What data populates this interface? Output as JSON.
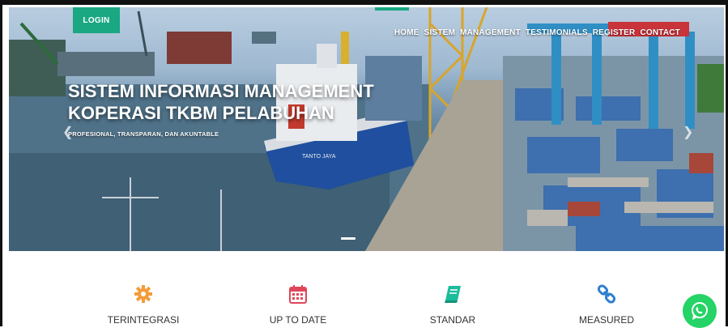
{
  "header": {
    "login_label": "LOGIN",
    "nav": [
      "HOME",
      "SISTEM",
      "MANAGEMENT",
      "TESTIMONIALS",
      "REGISTER",
      "CONTACT"
    ]
  },
  "hero": {
    "title_line1": "SISTEM INFORMASI MANAGEMENT",
    "title_line2": "KOPERASI TKBM PELABUHAN",
    "subtitle": "PROFESIONAL, TRANSPARAN, DAN AKUNTABLE",
    "ship_name": "TANTO JAYA",
    "arrow_left_icon": "chevron-left-icon",
    "arrow_right_icon": "chevron-right-icon"
  },
  "features": [
    {
      "label": "TERINTEGRASI",
      "icon": "gear-icon",
      "color": "#f39c3a"
    },
    {
      "label": "UP TO DATE",
      "icon": "calendar-icon",
      "color": "#e0465a"
    },
    {
      "label": "STANDAR",
      "icon": "book-icon",
      "color": "#1bbc9b"
    },
    {
      "label": "MEASURED",
      "icon": "link-icon",
      "color": "#2f7fd0"
    }
  ],
  "colors": {
    "accent": "#1aa882",
    "whatsapp": "#25d366"
  },
  "whatsapp": {
    "icon": "whatsapp-icon"
  }
}
